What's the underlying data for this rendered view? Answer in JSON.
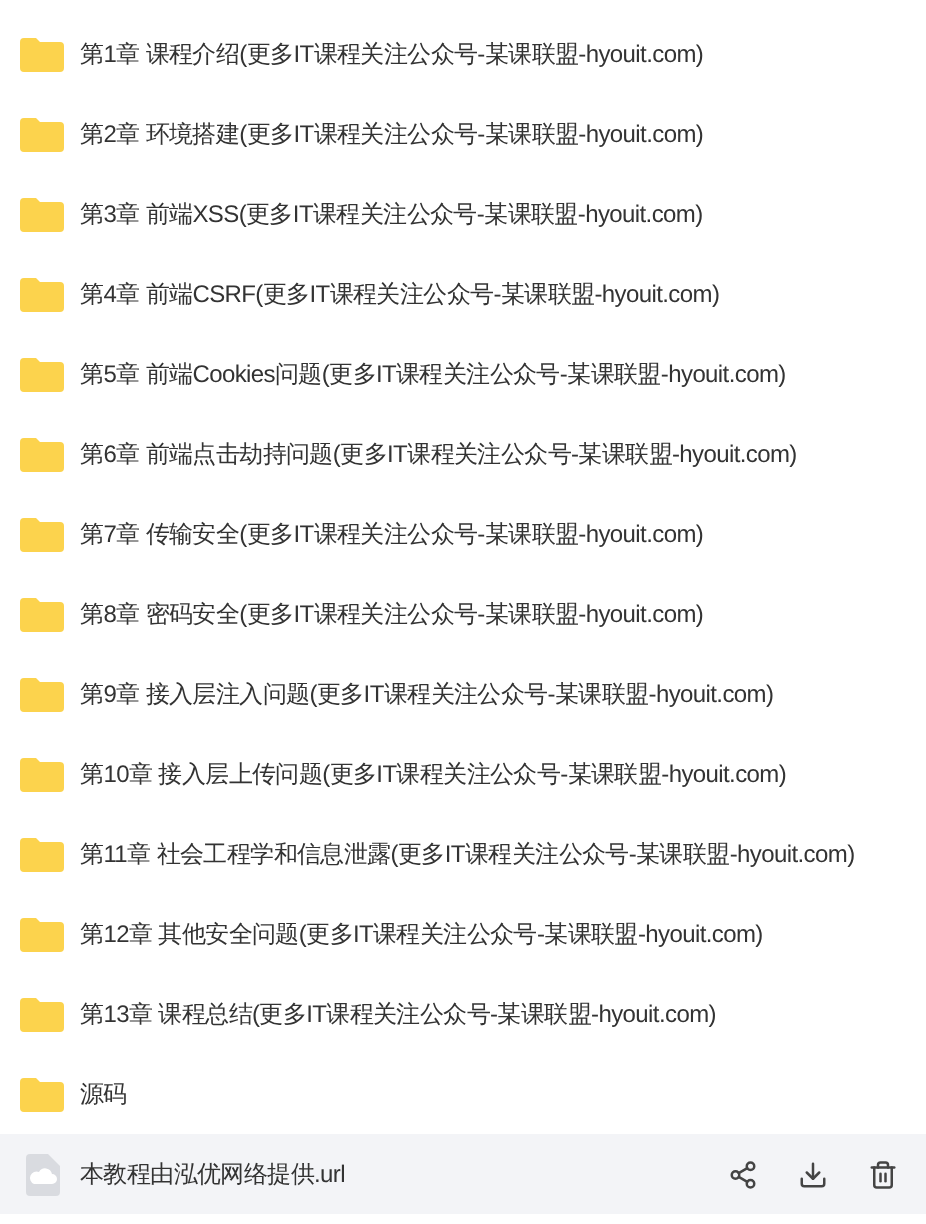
{
  "files": [
    {
      "kind": "folder",
      "name": "第1章 课程介绍(更多IT课程关注公众号-某课联盟-hyouit.com)",
      "selected": false
    },
    {
      "kind": "folder",
      "name": "第2章 环境搭建(更多IT课程关注公众号-某课联盟-hyouit.com)",
      "selected": false
    },
    {
      "kind": "folder",
      "name": "第3章 前端XSS(更多IT课程关注公众号-某课联盟-hyouit.com)",
      "selected": false
    },
    {
      "kind": "folder",
      "name": "第4章 前端CSRF(更多IT课程关注公众号-某课联盟-hyouit.com)",
      "selected": false
    },
    {
      "kind": "folder",
      "name": "第5章 前端Cookies问题(更多IT课程关注公众号-某课联盟-hyouit.com)",
      "selected": false
    },
    {
      "kind": "folder",
      "name": "第6章 前端点击劫持问题(更多IT课程关注公众号-某课联盟-hyouit.com)",
      "selected": false
    },
    {
      "kind": "folder",
      "name": "第7章 传输安全(更多IT课程关注公众号-某课联盟-hyouit.com)",
      "selected": false
    },
    {
      "kind": "folder",
      "name": "第8章 密码安全(更多IT课程关注公众号-某课联盟-hyouit.com)",
      "selected": false
    },
    {
      "kind": "folder",
      "name": "第9章 接入层注入问题(更多IT课程关注公众号-某课联盟-hyouit.com)",
      "selected": false
    },
    {
      "kind": "folder",
      "name": "第10章 接入层上传问题(更多IT课程关注公众号-某课联盟-hyouit.com)",
      "selected": false
    },
    {
      "kind": "folder",
      "name": "第11章 社会工程学和信息泄露(更多IT课程关注公众号-某课联盟-hyouit.com)",
      "selected": false
    },
    {
      "kind": "folder",
      "name": "第12章 其他安全问题(更多IT课程关注公众号-某课联盟-hyouit.com)",
      "selected": false
    },
    {
      "kind": "folder",
      "name": "第13章 课程总结(更多IT课程关注公众号-某课联盟-hyouit.com)",
      "selected": false
    },
    {
      "kind": "folder",
      "name": "源码",
      "selected": false
    },
    {
      "kind": "file",
      "name": "本教程由泓优网络提供.url",
      "selected": true
    }
  ]
}
